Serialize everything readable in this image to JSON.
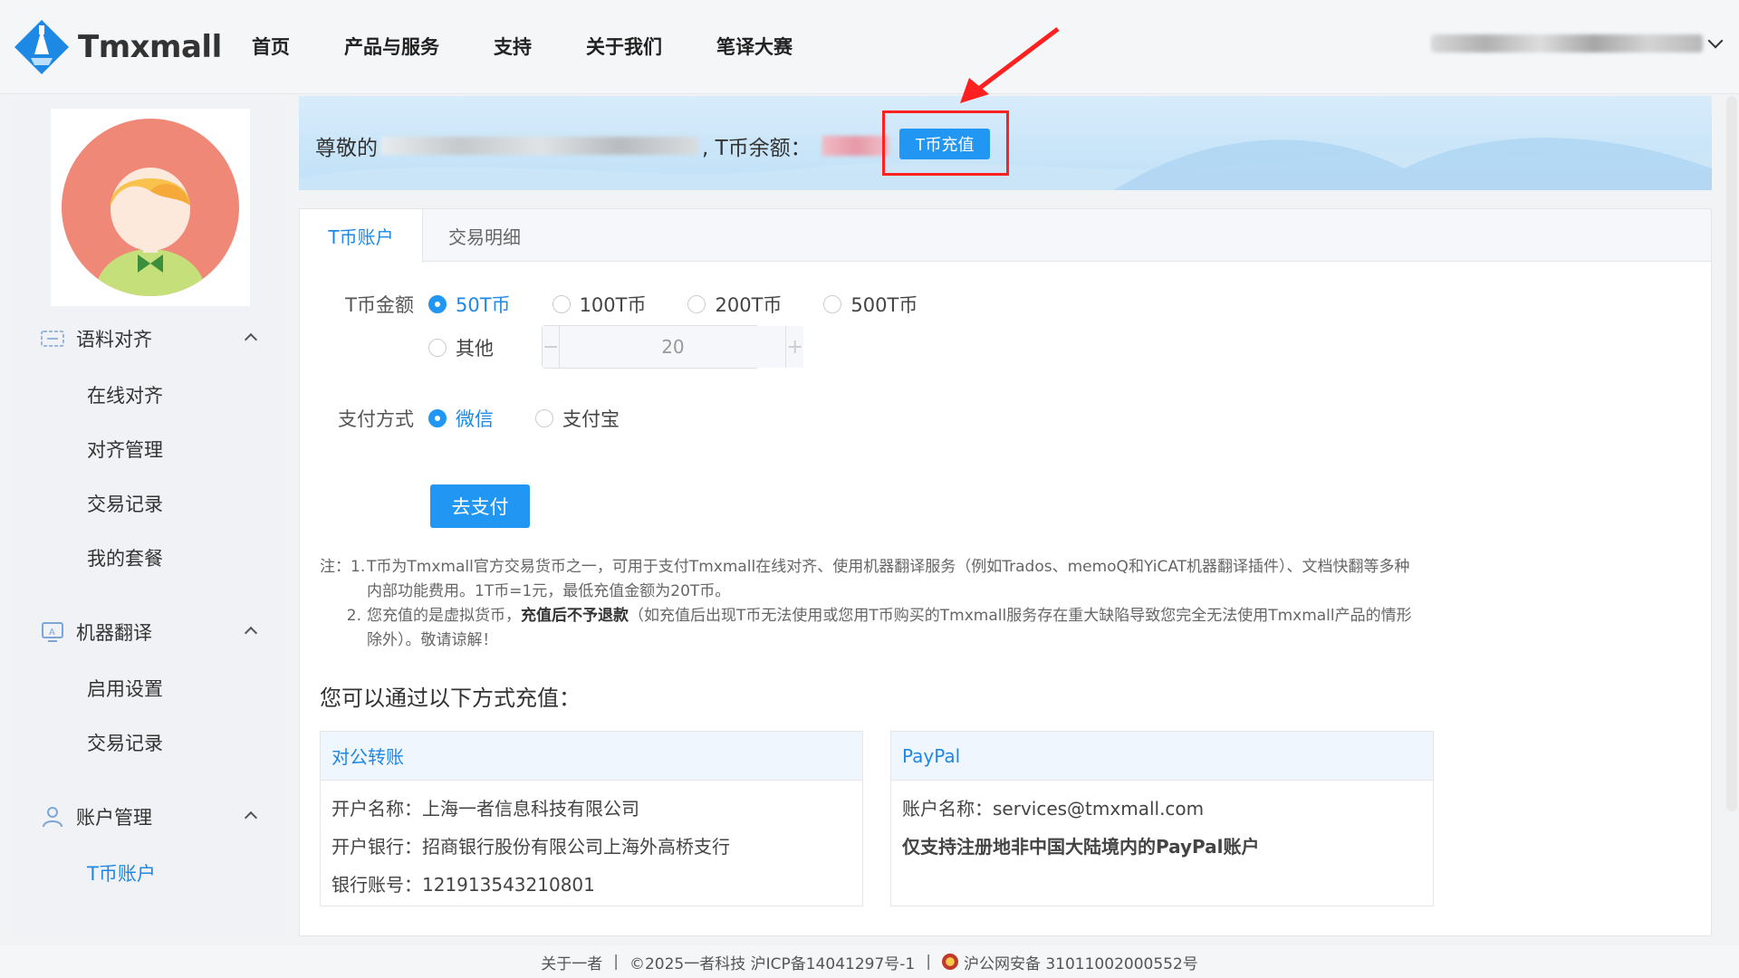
{
  "brand": {
    "name": "Tmxmall"
  },
  "nav": {
    "items": [
      "首页",
      "产品与服务",
      "支持",
      "关于我们",
      "笔译大赛"
    ]
  },
  "sidebar": {
    "groups": [
      {
        "label": "语料对齐",
        "icon": "align-icon",
        "items": [
          "在线对齐",
          "对齐管理",
          "交易记录",
          "我的套餐"
        ]
      },
      {
        "label": "机器翻译",
        "icon": "monitor-icon",
        "items": [
          "启用设置",
          "交易记录"
        ]
      },
      {
        "label": "账户管理",
        "icon": "user-icon",
        "items": [
          "T币账户"
        ]
      }
    ],
    "active_item": "T币账户"
  },
  "banner": {
    "greeting": "尊敬的",
    "balance_label": ", T币余额：",
    "recharge_label": "T币充值"
  },
  "tabs": [
    "T币账户",
    "交易明细"
  ],
  "form": {
    "amount_label": "T币金额",
    "amount_options": [
      "50T币",
      "100T币",
      "200T币",
      "500T币"
    ],
    "other_label": "其他",
    "other_value": "20",
    "payment_label": "支付方式",
    "payment_options": [
      "微信",
      "支付宝"
    ],
    "pay_button": "去支付"
  },
  "notes": {
    "prefix": "注：",
    "n1_num": "1.",
    "n1_line1": "T币为Tmxmall官方交易货币之一，可用于支付Tmxmall在线对齐、使用机器翻译服务（例如Trados、memoQ和YiCAT机器翻译插件）、文档快翻等多种",
    "n1_line2": "内部功能费用。1T币=1元，最低充值金额为20T币。",
    "n2_num": "2.",
    "n2_a": "您充值的是虚拟货币，",
    "n2_bold": "充值后不予退款",
    "n2_b": "（如充值后出现T币无法使用或您用T币购买的Tmxmall服务存在重大缺陷导致您完全无法使用Tmxmall产品的情形",
    "n2_line2": "除外）。敬请谅解！"
  },
  "recharge_methods": {
    "title": "您可以通过以下方式充值：",
    "bank": {
      "title": "对公转账",
      "lines": [
        "开户名称：上海一者信息科技有限公司",
        "开户银行：招商银行股份有限公司上海外高桥支行",
        "银行账号：121913543210801"
      ]
    },
    "paypal": {
      "title": "PayPal",
      "account": "账户名称：services@tmxmall.com",
      "note": "仅支持注册地非中国大陆境内的PayPal账户"
    }
  },
  "footer": {
    "about": "关于一者",
    "copyright": "©2025一者科技 沪ICP备14041297号-1",
    "police": "沪公网安备 31011002000552号"
  },
  "colors": {
    "accent": "#2196f3",
    "annotation": "#ff2020"
  }
}
